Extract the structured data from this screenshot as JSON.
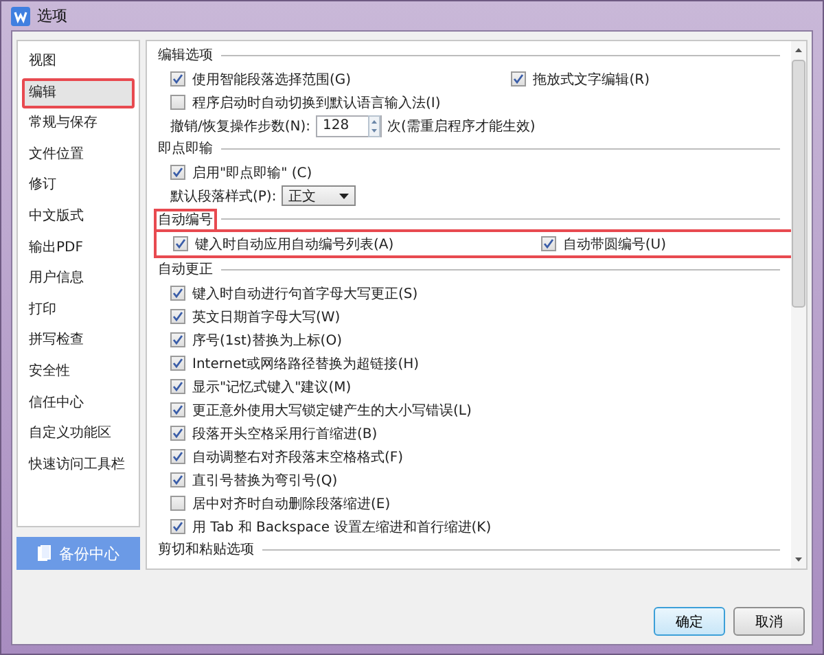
{
  "window": {
    "title": "选项"
  },
  "sidebar": {
    "items": [
      {
        "label": "视图",
        "selected": false,
        "highlighted": false
      },
      {
        "label": "编辑",
        "selected": true,
        "highlighted": true
      },
      {
        "label": "常规与保存",
        "selected": false,
        "highlighted": false
      },
      {
        "label": "文件位置",
        "selected": false,
        "highlighted": false
      },
      {
        "label": "修订",
        "selected": false,
        "highlighted": false
      },
      {
        "label": "中文版式",
        "selected": false,
        "highlighted": false
      },
      {
        "label": "输出PDF",
        "selected": false,
        "highlighted": false
      },
      {
        "label": "用户信息",
        "selected": false,
        "highlighted": false
      },
      {
        "label": "打印",
        "selected": false,
        "highlighted": false
      },
      {
        "label": "拼写检查",
        "selected": false,
        "highlighted": false
      },
      {
        "label": "安全性",
        "selected": false,
        "highlighted": false
      },
      {
        "label": "信任中心",
        "selected": false,
        "highlighted": false
      },
      {
        "label": "自定义功能区",
        "selected": false,
        "highlighted": false
      },
      {
        "label": "快速访问工具栏",
        "selected": false,
        "highlighted": false
      }
    ]
  },
  "backup_button": {
    "label": "备份中心"
  },
  "sections": [
    {
      "title": "编辑选项",
      "highlighted": false,
      "rows": [
        [
          {
            "kind": "checkbox",
            "label": "使用智能段落选择范围(G)",
            "checked": true
          },
          {
            "kind": "checkbox",
            "label": "拖放式文字编辑(R)",
            "checked": true
          }
        ],
        [
          {
            "kind": "checkbox",
            "label": "程序启动时自动切换到默认语言输入法(I)",
            "checked": false
          }
        ],
        [
          {
            "kind": "spin",
            "label": "撤销/恢复操作步数(N):",
            "value": "128",
            "note": "次(需重启程序才能生效)"
          }
        ]
      ]
    },
    {
      "title": "即点即输",
      "highlighted": false,
      "rows": [
        [
          {
            "kind": "checkbox",
            "label": "启用\"即点即输\" (C)",
            "checked": true
          }
        ],
        [
          {
            "kind": "select",
            "label": "默认段落样式(P):",
            "value": "正文"
          }
        ]
      ]
    },
    {
      "title": "自动编号",
      "highlighted": true,
      "rows": [
        [
          {
            "kind": "checkbox",
            "label": "键入时自动应用自动编号列表(A)",
            "checked": true
          },
          {
            "kind": "checkbox",
            "label": "自动带圆编号(U)",
            "checked": true
          }
        ]
      ]
    },
    {
      "title": "自动更正",
      "highlighted": false,
      "rows": [
        [
          {
            "kind": "checkbox",
            "label": "键入时自动进行句首字母大写更正(S)",
            "checked": true
          }
        ],
        [
          {
            "kind": "checkbox",
            "label": "英文日期首字母大写(W)",
            "checked": true
          }
        ],
        [
          {
            "kind": "checkbox",
            "label": "序号(1st)替换为上标(O)",
            "checked": true
          }
        ],
        [
          {
            "kind": "checkbox",
            "label": "Internet或网络路径替换为超链接(H)",
            "checked": true
          }
        ],
        [
          {
            "kind": "checkbox",
            "label": "显示\"记忆式键入\"建议(M)",
            "checked": true
          }
        ],
        [
          {
            "kind": "checkbox",
            "label": "更正意外使用大写锁定键产生的大小写错误(L)",
            "checked": true
          }
        ],
        [
          {
            "kind": "checkbox",
            "label": "段落开头空格采用行首缩进(B)",
            "checked": true
          }
        ],
        [
          {
            "kind": "checkbox",
            "label": "自动调整右对齐段落末空格格式(F)",
            "checked": true
          }
        ],
        [
          {
            "kind": "checkbox",
            "label": "直引号替换为弯引号(Q)",
            "checked": true
          }
        ],
        [
          {
            "kind": "checkbox",
            "label": "居中对齐时自动删除段落缩进(E)",
            "checked": false
          }
        ],
        [
          {
            "kind": "checkbox",
            "label": "用 Tab 和 Backspace 设置左缩进和首行缩进(K)",
            "checked": true
          }
        ]
      ]
    },
    {
      "title": "剪切和粘贴选项",
      "highlighted": false
    }
  ],
  "buttons": [
    {
      "label": "确定",
      "default": true
    },
    {
      "label": "取消",
      "default": false
    }
  ]
}
